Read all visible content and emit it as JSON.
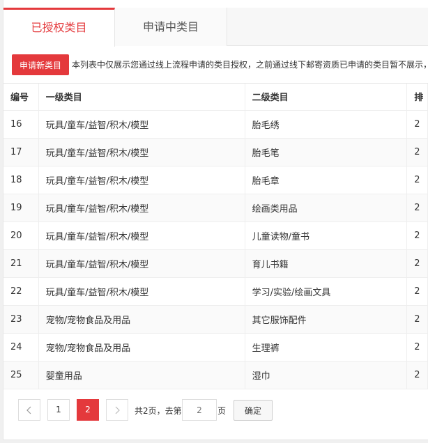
{
  "tabs": [
    {
      "label": "已授权类目",
      "active": true
    },
    {
      "label": "申请中类目",
      "active": false
    }
  ],
  "notice": {
    "button_label": "申请新类目",
    "text": "本列表中仅展示您通过线上流程申请的类目授权，之前通过线下邮寄资质已申请的类目暂不展示，"
  },
  "table": {
    "headers": [
      "编号",
      "一级类目",
      "二级类目",
      "排"
    ],
    "rows": [
      {
        "id": "16",
        "cat1": "玩具/童车/益智/积木/模型",
        "cat2": "胎毛绣",
        "cut": "2"
      },
      {
        "id": "17",
        "cat1": "玩具/童车/益智/积木/模型",
        "cat2": "胎毛笔",
        "cut": "2"
      },
      {
        "id": "18",
        "cat1": "玩具/童车/益智/积木/模型",
        "cat2": "胎毛章",
        "cut": "2"
      },
      {
        "id": "19",
        "cat1": "玩具/童车/益智/积木/模型",
        "cat2": "绘画类用品",
        "cut": "2"
      },
      {
        "id": "20",
        "cat1": "玩具/童车/益智/积木/模型",
        "cat2": "儿童读物/童书",
        "cut": "2"
      },
      {
        "id": "21",
        "cat1": "玩具/童车/益智/积木/模型",
        "cat2": "育儿书籍",
        "cut": "2"
      },
      {
        "id": "22",
        "cat1": "玩具/童车/益智/积木/模型",
        "cat2": "学习/实验/绘画文具",
        "cut": "2"
      },
      {
        "id": "23",
        "cat1": "宠物/宠物食品及用品",
        "cat2": "其它服饰配件",
        "cut": "2"
      },
      {
        "id": "24",
        "cat1": "宠物/宠物食品及用品",
        "cat2": "生理裤",
        "cut": "2"
      },
      {
        "id": "25",
        "cat1": "婴童用品",
        "cat2": "湿巾",
        "cut": "2"
      }
    ]
  },
  "pager": {
    "pages": [
      "1",
      "2"
    ],
    "current": "2",
    "total_text": "共2页，去第",
    "input_placeholder": "2",
    "page_suffix": "页",
    "confirm_label": "确定"
  },
  "colors": {
    "accent": "#e4393c"
  }
}
